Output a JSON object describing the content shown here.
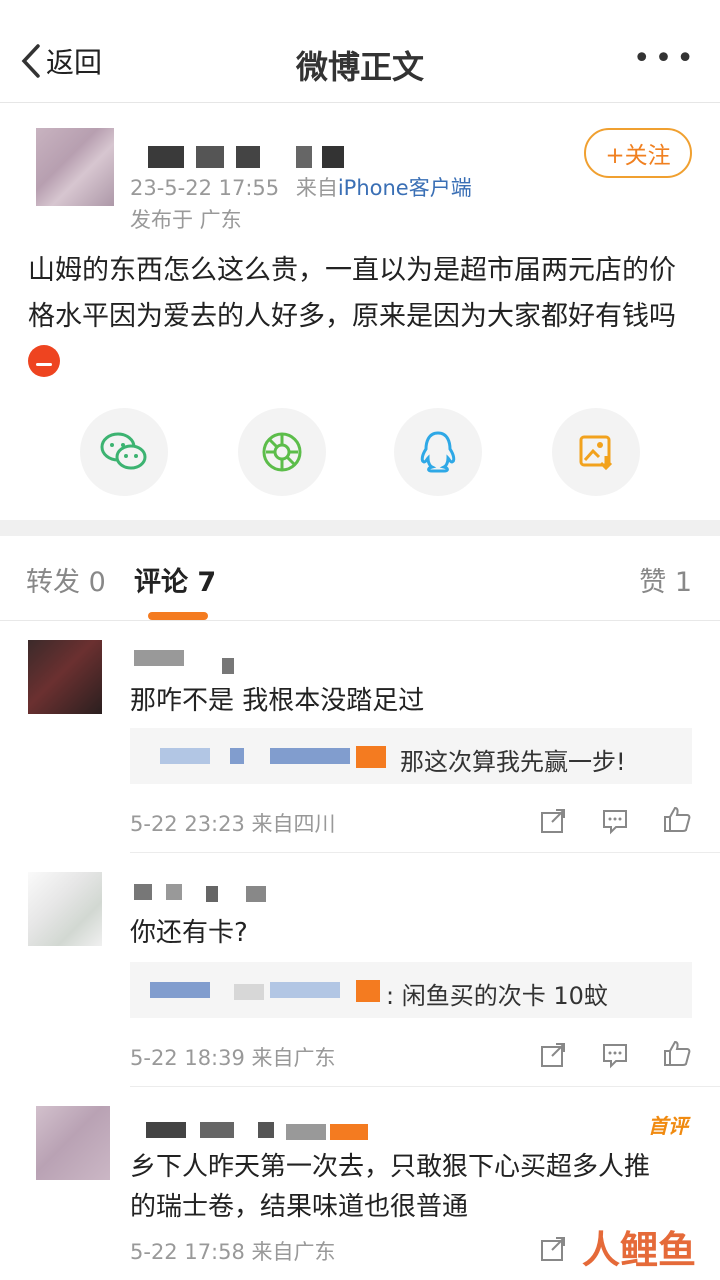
{
  "header": {
    "back_label": "返回",
    "title": "微博正文",
    "more_label": "•••"
  },
  "post": {
    "time": "23-5-22 17:55",
    "source_prefix": "来自",
    "source": "iPhone客户端",
    "location": "发布于 广东",
    "follow_label": "+关注",
    "text": "山姆的东西怎么这么贵，一直以为是超市届两元店的价格水平因为爱去的人好多，原来是因为大家都好有钱吗"
  },
  "share_icons": [
    "wechat-icon",
    "moments-icon",
    "qq-icon",
    "save-image-icon"
  ],
  "tabs": {
    "repost": "转发 0",
    "comment": "评论 7",
    "like": "赞 1"
  },
  "comments": [
    {
      "text": "那咋不是 我根本没踏足过",
      "reply": "那这次算我先赢一步!",
      "meta": "5-22 23:23 来自四川"
    },
    {
      "text": "你还有卡?",
      "reply": ": 闲鱼买的次卡 10蚊",
      "meta": "5-22 18:39 来自广东"
    },
    {
      "badge": "首评",
      "text_line1": "乡下人昨天第一次去，只敢狠下心买超多人推",
      "text_line2": "的瑞士卷，结果味道也很普通",
      "meta": "5-22 17:58 来自广东"
    }
  ],
  "watermark": "人鲤鱼",
  "colors": {
    "accent": "#f47b20",
    "link": "#3a6fb5",
    "follow": "#f08020"
  }
}
